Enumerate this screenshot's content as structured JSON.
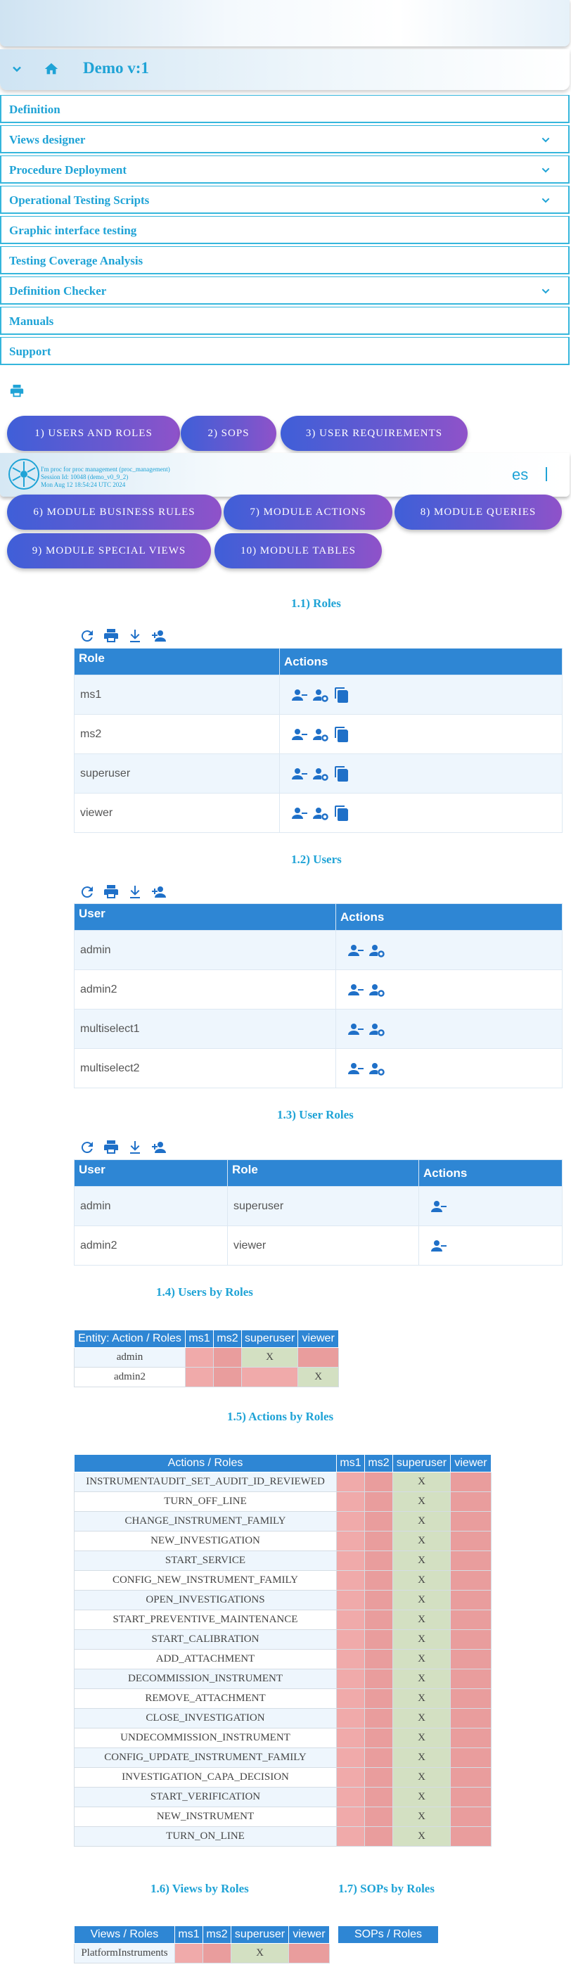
{
  "header": {
    "title": "Demo v:1"
  },
  "menu": [
    {
      "label": "Definition",
      "dropdown": false
    },
    {
      "label": "Views designer",
      "dropdown": true
    },
    {
      "label": "Procedure Deployment",
      "dropdown": true
    },
    {
      "label": "Operational Testing Scripts",
      "dropdown": true
    },
    {
      "label": "Graphic interface testing",
      "dropdown": false
    },
    {
      "label": "Testing Coverage Analysis",
      "dropdown": false
    },
    {
      "label": "Definition Checker",
      "dropdown": true
    },
    {
      "label": "Manuals",
      "dropdown": false
    },
    {
      "label": "Support",
      "dropdown": false
    }
  ],
  "tabs": [
    "1) USERS AND ROLES",
    "2) SOPS",
    "3) USER REQUIREMENTS",
    "6) MODULE BUSINESS RULES",
    "7) MODULE ACTIONS",
    "8) MODULE QUERIES",
    "9) MODULE SPECIAL VIEWS",
    "10) MODULE TABLES"
  ],
  "session": {
    "line1": "I'm proc for proc management (proc_management)",
    "line2": "Session Id: 10048 (demo_v0_9_2)",
    "line3": "Mon Aug 12 18:54:24 UTC 2024",
    "lang": "es"
  },
  "roles": {
    "title": "1.1) Roles",
    "headers": [
      "Role",
      "Actions"
    ],
    "rows": [
      "ms1",
      "ms2",
      "superuser",
      "viewer"
    ]
  },
  "users": {
    "title": "1.2) Users",
    "headers": [
      "User",
      "Actions"
    ],
    "rows": [
      "admin",
      "admin2",
      "multiselect1",
      "multiselect2"
    ]
  },
  "user_roles": {
    "title": "1.3) User Roles",
    "headers": [
      "User",
      "Role",
      "Actions"
    ],
    "rows": [
      [
        "admin",
        "superuser"
      ],
      [
        "admin2",
        "viewer"
      ]
    ]
  },
  "users_by_roles": {
    "title": "1.4) Users by Roles",
    "headers": [
      "Entity: Action / Roles",
      "ms1",
      "ms2",
      "superuser",
      "viewer"
    ],
    "rows": [
      {
        "name": "admin",
        "cells": [
          "",
          "",
          "X",
          ""
        ]
      },
      {
        "name": "admin2",
        "cells": [
          "",
          "",
          "",
          "X"
        ]
      }
    ]
  },
  "actions_by_roles": {
    "title": "1.5) Actions by Roles",
    "headers": [
      "Actions / Roles",
      "ms1",
      "ms2",
      "superuser",
      "viewer"
    ],
    "mark": "X",
    "rows": [
      "INSTRUMENTAUDIT_SET_AUDIT_ID_REVIEWED",
      "TURN_OFF_LINE",
      "CHANGE_INSTRUMENT_FAMILY",
      "NEW_INVESTIGATION",
      "START_SERVICE",
      "CONFIG_NEW_INSTRUMENT_FAMILY",
      "OPEN_INVESTIGATIONS",
      "START_PREVENTIVE_MAINTENANCE",
      "START_CALIBRATION",
      "ADD_ATTACHMENT",
      "DECOMMISSION_INSTRUMENT",
      "REMOVE_ATTACHMENT",
      "CLOSE_INVESTIGATION",
      "UNDECOMMISSION_INSTRUMENT",
      "CONFIG_UPDATE_INSTRUMENT_FAMILY",
      "INVESTIGATION_CAPA_DECISION",
      "START_VERIFICATION",
      "NEW_INSTRUMENT",
      "TURN_ON_LINE"
    ]
  },
  "views_by_roles": {
    "title": "1.6) Views by Roles",
    "headers": [
      "Views / Roles",
      "ms1",
      "ms2",
      "superuser",
      "viewer"
    ],
    "rows": [
      {
        "name": "PlatformInstruments",
        "cells": [
          "",
          "",
          "X",
          ""
        ]
      }
    ]
  },
  "sops_by_roles": {
    "title": "1.7) SOPs by Roles",
    "headers": [
      "SOPs / Roles"
    ]
  },
  "colors": {
    "accent": "#1fa3d6",
    "table_header": "#2e86d4",
    "denied": "#f0aaaa",
    "granted": "#d3e0c2"
  }
}
